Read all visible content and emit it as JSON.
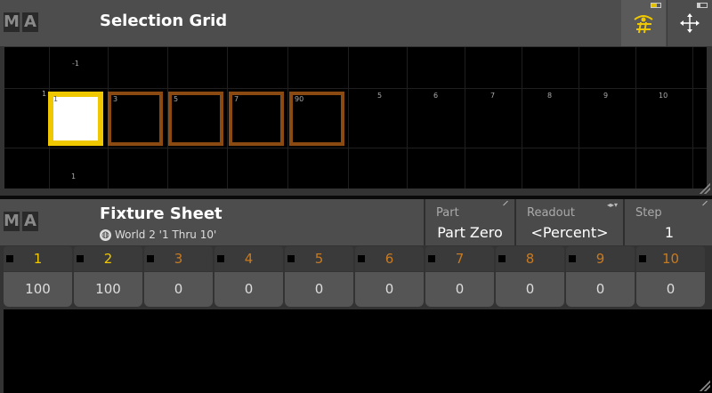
{
  "logo": [
    "M",
    "A"
  ],
  "selection_grid": {
    "title": "Selection Grid",
    "top_labels": [
      "-1"
    ],
    "left_labels": [
      "1"
    ],
    "bottom_labels": [
      "1"
    ],
    "cells": [
      {
        "label": "1",
        "state": "selected"
      },
      {
        "label": "3",
        "state": "active"
      },
      {
        "label": "5",
        "state": "active"
      },
      {
        "label": "7",
        "state": "active"
      },
      {
        "label": "90",
        "state": "active"
      }
    ],
    "column_labels": [
      "5",
      "6",
      "7",
      "8",
      "9",
      "10"
    ],
    "colors": {
      "selected": "#f0c800",
      "active": "#8a4a12",
      "background": "#000000"
    },
    "toolbar_icons": [
      "selection-grid-icon",
      "move-arrows-icon"
    ]
  },
  "fixture_sheet": {
    "title": "Fixture Sheet",
    "world_label": "World 2 '1 Thru 10'",
    "params": [
      {
        "label": "Part",
        "value": "Part Zero"
      },
      {
        "label": "Readout",
        "value": "<Percent>"
      },
      {
        "label": "Step",
        "value": "1"
      }
    ],
    "fixtures": [
      {
        "id": "1",
        "value": "100",
        "state": "selected"
      },
      {
        "id": "2",
        "value": "100",
        "state": "selected"
      },
      {
        "id": "3",
        "value": "0",
        "state": "unselected"
      },
      {
        "id": "4",
        "value": "0",
        "state": "unselected"
      },
      {
        "id": "5",
        "value": "0",
        "state": "unselected"
      },
      {
        "id": "6",
        "value": "0",
        "state": "unselected"
      },
      {
        "id": "7",
        "value": "0",
        "state": "unselected"
      },
      {
        "id": "8",
        "value": "0",
        "state": "unselected"
      },
      {
        "id": "9",
        "value": "0",
        "state": "unselected"
      },
      {
        "id": "10",
        "value": "0",
        "state": "unselected"
      }
    ],
    "colors": {
      "selected_id": "#f0c800",
      "unselected_id": "#c87a20"
    }
  }
}
